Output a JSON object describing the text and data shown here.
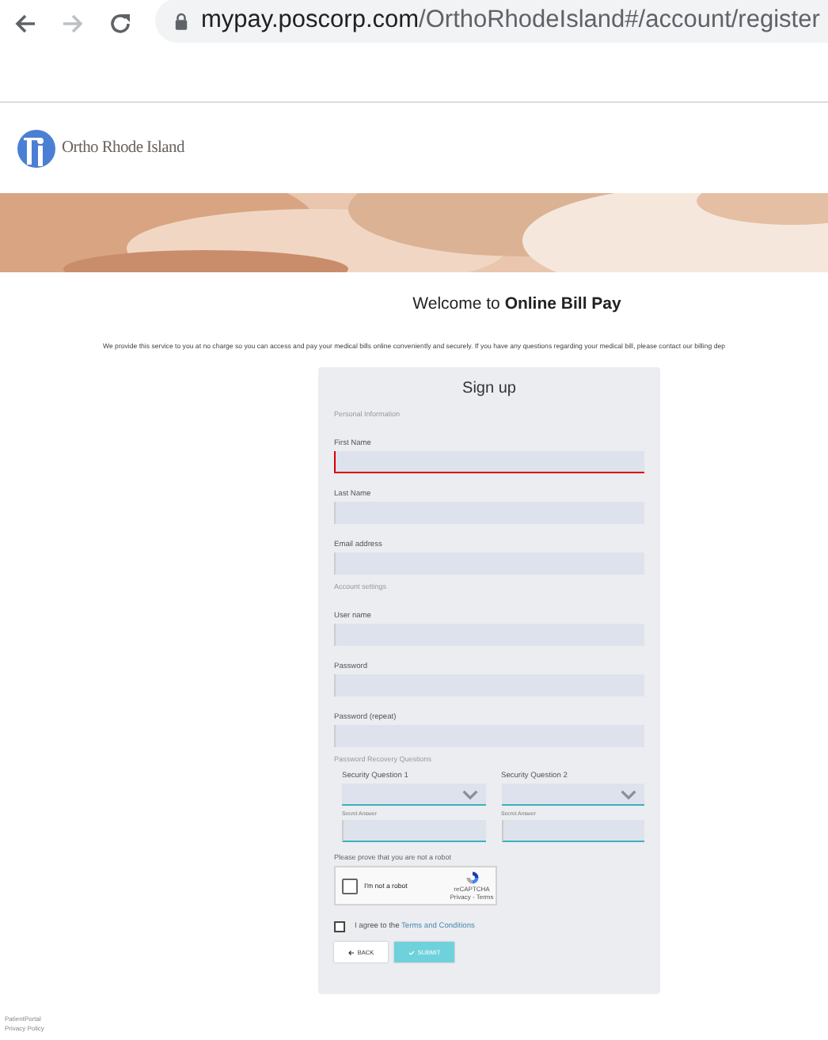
{
  "browser": {
    "forward_disabled": true,
    "url_host": "mypay.poscorp.com",
    "url_path": "/OrthoRhodeIsland#/account/register"
  },
  "logo": {
    "name": "Ortho Rhode Island"
  },
  "welcome": {
    "prefix": "Welcome to ",
    "emphasis": "Online Bill Pay"
  },
  "intro": "We provide this service to you at no charge so you can access and pay your medical bills online conveniently and securely. If you have any questions regarding your medical bill, please contact our billing dep",
  "form": {
    "title": "Sign up",
    "items": [
      {
        "kind": "section",
        "text": "Personal Information"
      },
      {
        "kind": "input",
        "label": "First Name",
        "focused": true
      },
      {
        "kind": "input",
        "label": "Last Name",
        "focused": false
      },
      {
        "kind": "input",
        "label": "Email address",
        "focused": false
      },
      {
        "kind": "section",
        "text": "Account settings"
      },
      {
        "kind": "input",
        "label": "User name",
        "focused": false
      },
      {
        "kind": "input",
        "label": "Password",
        "focused": false
      },
      {
        "kind": "input",
        "label": "Password (repeat)",
        "focused": false
      },
      {
        "kind": "section",
        "text": "Password Recovery Questions"
      },
      {
        "kind": "pair",
        "columns": [
          {
            "kind": "select",
            "label": "Security Question 1"
          },
          {
            "kind": "select",
            "label": "Security Question 2"
          }
        ]
      },
      {
        "kind": "pair",
        "columns": [
          {
            "kind": "answer",
            "label": "Secret Answer"
          },
          {
            "kind": "answer",
            "label": "Secret Answer"
          }
        ]
      }
    ],
    "captcha": {
      "prompt": "Please prove that you are not a robot",
      "label": "I'm not a robot",
      "checked": false,
      "brand": "reCAPTCHA",
      "links": "Privacy - Terms"
    },
    "terms": {
      "checked": false,
      "text": "I agree to the ",
      "link": "Terms and Conditions"
    },
    "buttons": [
      {
        "kind": "back",
        "label": "BACK"
      },
      {
        "kind": "submit",
        "label": "SUBMIT"
      }
    ]
  },
  "footer": [
    "PatientPortal",
    "Privacy Policy"
  ]
}
